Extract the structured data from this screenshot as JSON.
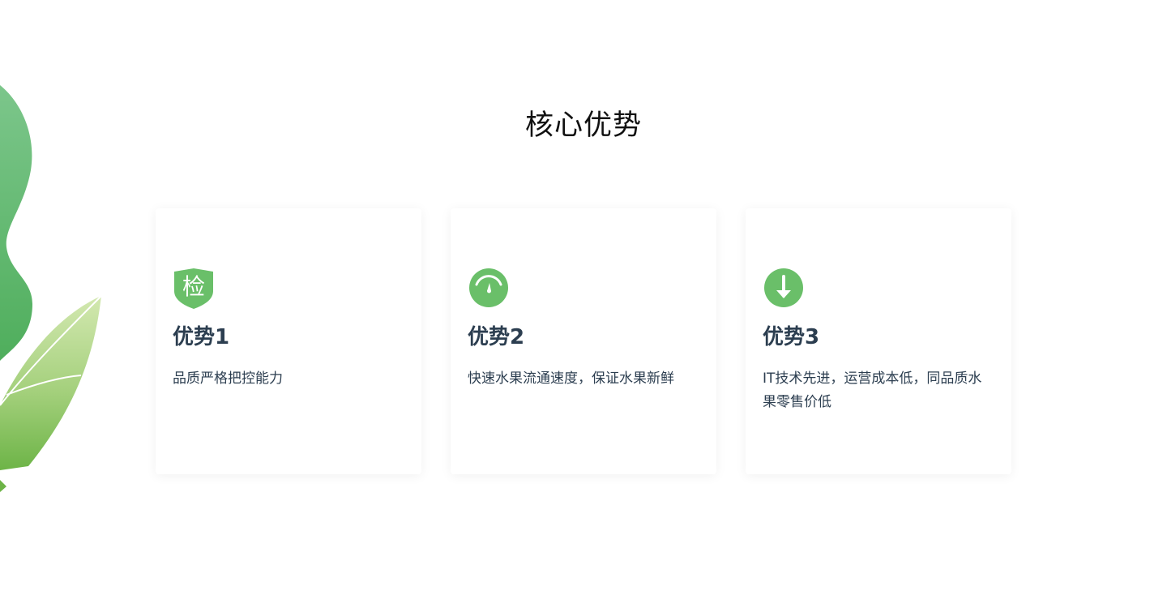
{
  "section": {
    "title": "核心优势"
  },
  "colors": {
    "accent": "#6abf69",
    "title": "#111111",
    "text": "#2c3e50"
  },
  "cards": [
    {
      "icon": "shield-inspection-icon",
      "icon_text": "检",
      "title": "优势1",
      "description": "品质严格把控能力"
    },
    {
      "icon": "speedometer-icon",
      "title": "优势2",
      "description": "快速水果流通速度，保证水果新鲜"
    },
    {
      "icon": "arrow-down-circle-icon",
      "title": "优势3",
      "description": "IT技术先进，运营成本低，同品质水果零售价低"
    }
  ]
}
